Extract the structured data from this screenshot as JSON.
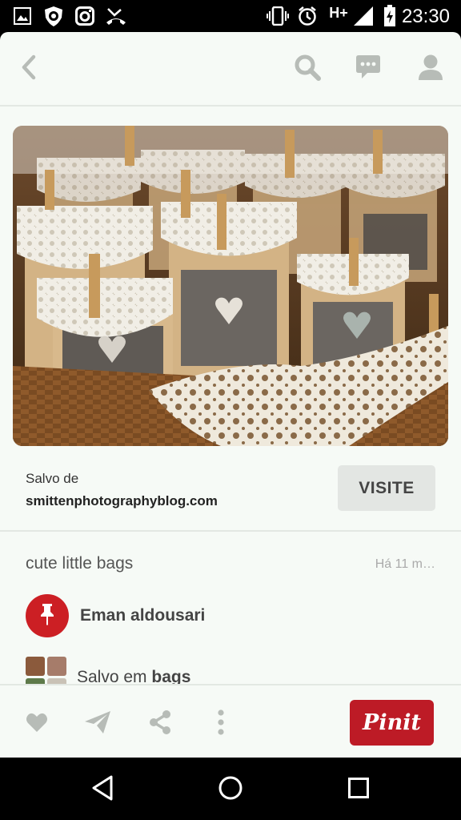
{
  "status_bar": {
    "time": "23:30",
    "network": "H+",
    "icons": [
      "image-icon",
      "shield-icon",
      "instagram-icon",
      "missed-call-icon",
      "vibrate-icon",
      "alarm-icon",
      "signal-icon",
      "battery-icon"
    ]
  },
  "top_bar": {
    "icons": [
      "back-icon",
      "search-icon",
      "chat-icon",
      "profile-icon"
    ],
    "icon_color": "#b7bcb7"
  },
  "pin": {
    "image_alt": "Lace doily paper bag favors with clothespins in a wicker basket",
    "saved_from_label": "Salvo de",
    "source_domain": "smittenphotographyblog.com",
    "visit_label": "VISITE",
    "description": "cute little bags",
    "time_ago": "Há 11 m…",
    "pinner_name": "Eman aldousari",
    "board_prefix": "Salvo em ",
    "board_name": "bags"
  },
  "actions": {
    "icons": [
      "heart-icon",
      "send-icon",
      "share-icon",
      "more-vertical-icon"
    ],
    "pin_it_label": "Pinit"
  },
  "nav_bar": {
    "icons": [
      "nav-back-icon",
      "nav-home-icon",
      "nav-recents-icon"
    ]
  },
  "colors": {
    "brand_red": "#bd1b26",
    "avatar_red": "#cc1f24",
    "background": "#f6faf6",
    "visit_button": "#e3e6e3"
  }
}
